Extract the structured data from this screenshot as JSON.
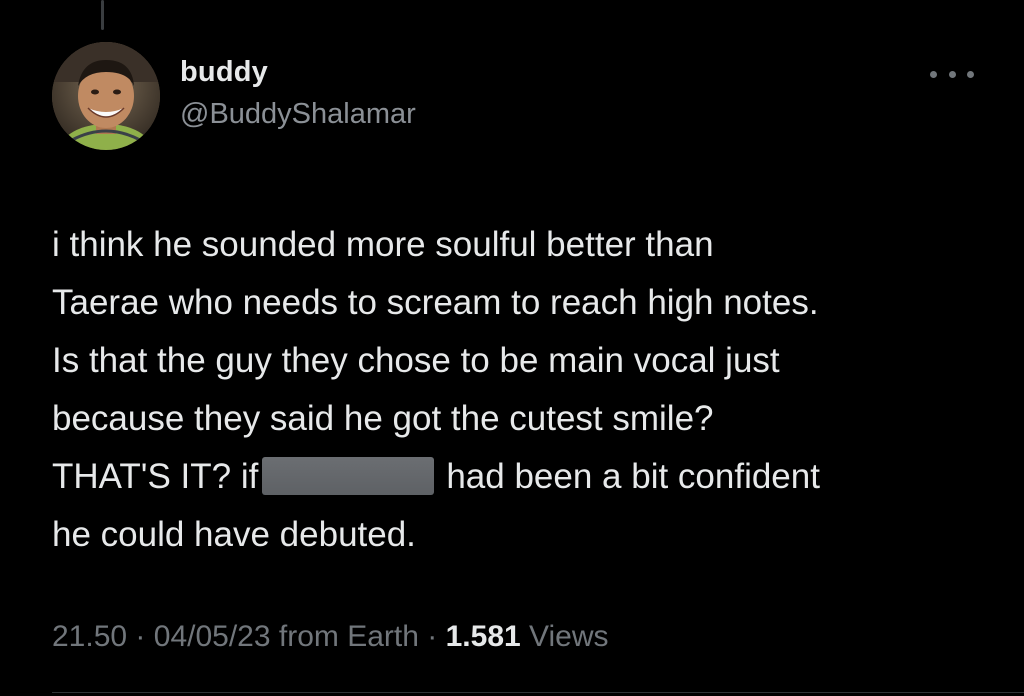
{
  "author": {
    "display_name": "buddy",
    "handle": "@BuddyShalamar",
    "avatar_icon": "avatar-photo"
  },
  "menu": {
    "more_icon": "more-horizontal-icon"
  },
  "tweet": {
    "lines": [
      "i think he sounded more soulful better than",
      "Taerae who needs to scream to reach high notes.",
      "Is that the guy they chose to be main vocal just",
      "because they said he got the cutest smile?"
    ],
    "line5_before": "THAT'S IT? if",
    "line5_after": "had been a bit confident",
    "line6": "he could have debuted."
  },
  "meta": {
    "time": "21.50",
    "separator": "·",
    "date": "04/05/23",
    "source": "from Earth",
    "views_count": "1.581",
    "views_label": "Views"
  },
  "colors": {
    "background": "#000000",
    "primary_text": "#e7e9ea",
    "secondary_text": "#71767b",
    "redaction": "#64676b"
  }
}
